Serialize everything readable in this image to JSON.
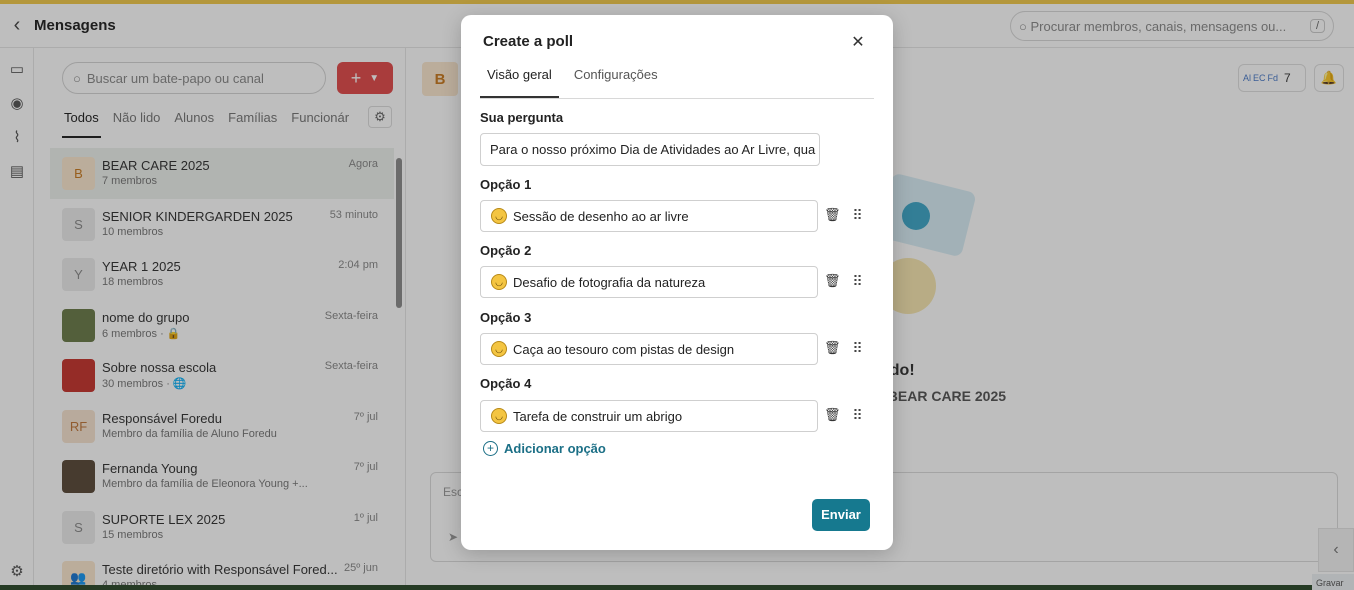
{
  "app": {
    "title": "Mensagens",
    "global_search_placeholder": "Procurar membros, canais, mensagens ou...",
    "shortcut": "/"
  },
  "sidebar": {
    "search_placeholder": "Buscar um bate-papo ou canal",
    "new_button": "+",
    "tabs": [
      "Todos",
      "Não lido",
      "Alunos",
      "Famílias",
      "Funcionár"
    ],
    "active_tab": "Todos",
    "chats": [
      {
        "initial": "B",
        "name": "BEAR CARE 2025",
        "sub": "7 membros",
        "time": "Agora"
      },
      {
        "initial": "S",
        "name": "SENIOR KINDERGARDEN 2025",
        "sub": "10 membros",
        "time": "53 minuto"
      },
      {
        "initial": "Y",
        "name": "YEAR 1 2025",
        "sub": "18 membros",
        "time": "2:04 pm"
      },
      {
        "initial": "",
        "name": "nome do grupo",
        "sub": "6 membros · 🔒",
        "time": "Sexta-feira"
      },
      {
        "initial": "",
        "name": "Sobre nossa escola",
        "sub": "30 membros · 🌐",
        "time": "Sexta-feira"
      },
      {
        "initial": "RF",
        "name": "Responsável Foredu",
        "sub": "Membro da família de Aluno Foredu",
        "time": "7º jul"
      },
      {
        "initial": "",
        "name": "Fernanda Young",
        "sub": "Membro da família de Eleonora Young +...",
        "time": "7º jul"
      },
      {
        "initial": "S",
        "name": "SUPORTE LEX 2025",
        "sub": "15 membros",
        "time": "1º jul"
      },
      {
        "initial": "",
        "name": "Teste diretório with Responsável Fored...",
        "sub": "4 membros",
        "time": "25º jun"
      }
    ]
  },
  "main": {
    "channel_initial": "B",
    "member_chips": [
      "Al",
      "EC",
      "Fd"
    ],
    "member_count": "7",
    "welcome_title": "ndo!",
    "welcome_sub": "l BEAR CARE 2025",
    "composer_placeholder": "Esc",
    "gravar": "Gravar"
  },
  "modal": {
    "title": "Create a poll",
    "tabs": [
      "Visão geral",
      "Configurações"
    ],
    "active_tab": "Visão geral",
    "question_label": "Sua pergunta",
    "question_value": "Para o nosso próximo Dia de Atividades ao Ar Livre, qua",
    "options": [
      {
        "label": "Opção 1",
        "value": "Sessão de desenho ao ar livre",
        "emoji": "😆"
      },
      {
        "label": "Opção 2",
        "value": "Desafio de fotografia da natureza",
        "emoji": "😉"
      },
      {
        "label": "Opção 3",
        "value": "Caça ao tesouro com pistas de design",
        "emoji": "😍"
      },
      {
        "label": "Opção 4",
        "value": "Tarefa de construir um abrigo",
        "emoji": "😀"
      }
    ],
    "add_option": "Adicionar opção",
    "submit": "Enviar"
  }
}
